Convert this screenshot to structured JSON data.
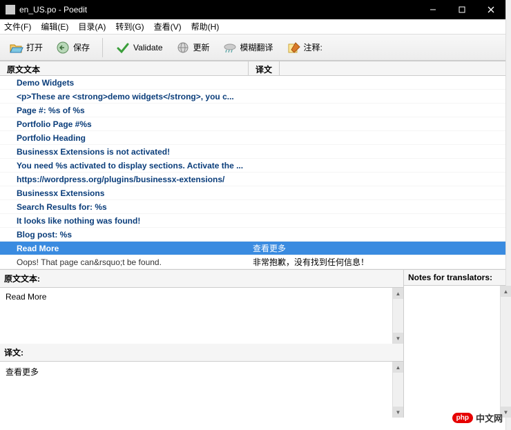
{
  "window": {
    "title": "en_US.po - Poedit"
  },
  "menu": {
    "file": "文件(F)",
    "edit": "编辑(E)",
    "catalog": "目录(A)",
    "goto": "转到(G)",
    "view": "查看(V)",
    "help": "帮助(H)"
  },
  "toolbar": {
    "open": "打开",
    "save": "保存",
    "validate": "Validate",
    "update": "更新",
    "fuzzy": "模糊翻译",
    "comment": "注释:"
  },
  "columns": {
    "source": "原文文本",
    "translation": "译文"
  },
  "rows": [
    {
      "source": "Demo Widgets",
      "translation": "",
      "style": "bold"
    },
    {
      "source": "<p>These are <strong>demo widgets</strong>, you c...",
      "translation": "",
      "style": "bold"
    },
    {
      "source": "Page #: %s of %s",
      "translation": "",
      "style": "bold"
    },
    {
      "source": "Portfolio Page #%s",
      "translation": "",
      "style": "bold"
    },
    {
      "source": "Portfolio Heading",
      "translation": "",
      "style": "bold"
    },
    {
      "source": "Businessx Extensions is not activated!",
      "translation": "",
      "style": "bold"
    },
    {
      "source": "You need %s activated to display sections. Activate the ...",
      "translation": "",
      "style": "bold"
    },
    {
      "source": "https://wordpress.org/plugins/businessx-extensions/",
      "translation": "",
      "style": "bold"
    },
    {
      "source": "Businessx Extensions",
      "translation": "",
      "style": "bold"
    },
    {
      "source": "Search Results for: %s",
      "translation": "",
      "style": "bold"
    },
    {
      "source": "It looks like nothing was found!",
      "translation": "",
      "style": "bold"
    },
    {
      "source": "Blog post: %s",
      "translation": "",
      "style": "bold"
    },
    {
      "source": "Read More",
      "translation": "查看更多",
      "style": "selected"
    },
    {
      "source": "Oops! That page can&rsquo;t be found.",
      "translation": "非常抱歉，没有找到任何信息！",
      "style": "normal"
    }
  ],
  "editor": {
    "source_label": "原文文本:",
    "source_value": "Read More",
    "translation_label": "译文:",
    "translation_value": "查看更多",
    "notes_label": "Notes for translators:"
  },
  "watermark": {
    "badge": "php",
    "text": "中文网"
  }
}
